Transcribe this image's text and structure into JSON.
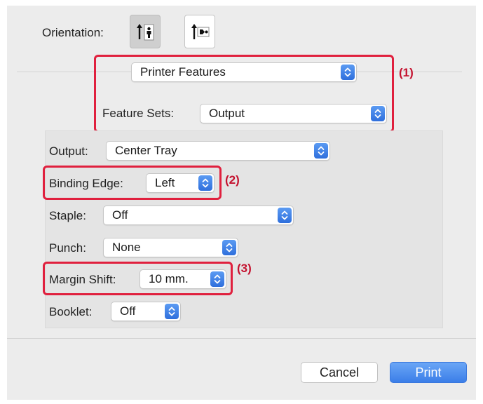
{
  "orientation": {
    "label": "Orientation:"
  },
  "printer_features": {
    "selected": "Printer Features"
  },
  "feature_sets": {
    "label": "Feature Sets:",
    "selected": "Output"
  },
  "settings": {
    "output": {
      "label": "Output:",
      "selected": "Center Tray"
    },
    "binding_edge": {
      "label": "Binding Edge:",
      "selected": "Left"
    },
    "staple": {
      "label": "Staple:",
      "selected": "Off"
    },
    "punch": {
      "label": "Punch:",
      "selected": "None"
    },
    "margin_shift": {
      "label": "Margin Shift:",
      "selected": "10 mm."
    },
    "booklet": {
      "label": "Booklet:",
      "selected": "Off"
    }
  },
  "callouts": {
    "one": "(1)",
    "two": "(2)",
    "three": "(3)"
  },
  "buttons": {
    "cancel": "Cancel",
    "print": "Print"
  },
  "colors": {
    "callout": "#e0203e",
    "accent": "#3b7ee8"
  },
  "icons": [
    "portrait-orientation-icon",
    "landscape-orientation-icon",
    "popup-stepper-icon"
  ]
}
